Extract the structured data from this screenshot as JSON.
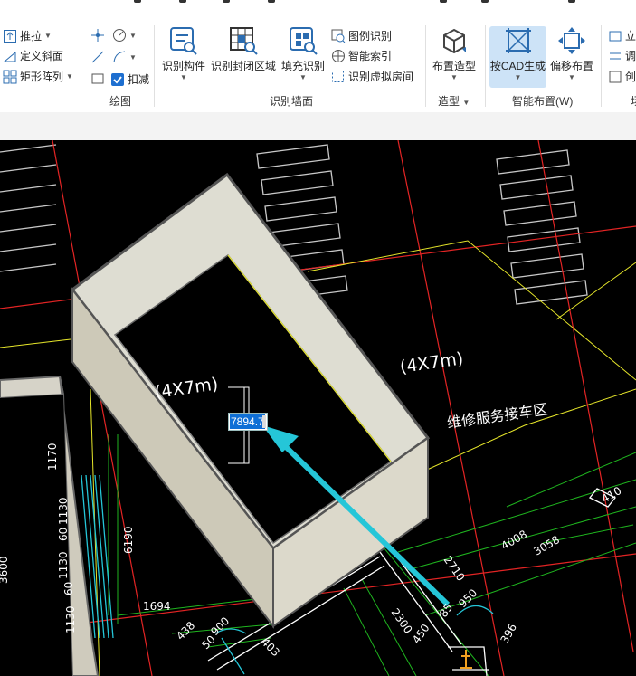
{
  "ribbon": {
    "draw_group": {
      "label": "绘图",
      "items": [
        "推拉",
        "定义斜面",
        "矩形阵列",
        "扣减"
      ]
    },
    "wall_group": {
      "label": "识别墙面",
      "big_buttons": [
        "识别构件",
        "识别封闭区域",
        "填充识别"
      ],
      "small_buttons": [
        "图例识别",
        "智能索引",
        "识别虚拟房间"
      ]
    },
    "model_group": {
      "label": "造型",
      "big_buttons": [
        "布置造型"
      ]
    },
    "smart_group": {
      "label": "智能布置(W)",
      "big_buttons": [
        "按CAD生成",
        "偏移布置"
      ]
    },
    "partial_group": {
      "items": [
        "立",
        "调",
        "创"
      ],
      "label": "场"
    }
  },
  "cad": {
    "dimension_input": "7894.7",
    "room_label": "维修服务接车区",
    "size_labels": [
      "(4X7m)",
      "(4X7m)"
    ],
    "dimensions": [
      "1170",
      "1130",
      "60",
      "1130",
      "60",
      "1130",
      "6190",
      "3600",
      "1694",
      "438",
      "50",
      "900",
      "403",
      "2300",
      "450",
      "85",
      "950",
      "396",
      "2710",
      "4008",
      "3058",
      "410"
    ]
  },
  "colors": {
    "accent": "#cde3f7",
    "selection": "#0f6fd6",
    "arrow": "#25c6d8",
    "cad_background": "#000000"
  }
}
